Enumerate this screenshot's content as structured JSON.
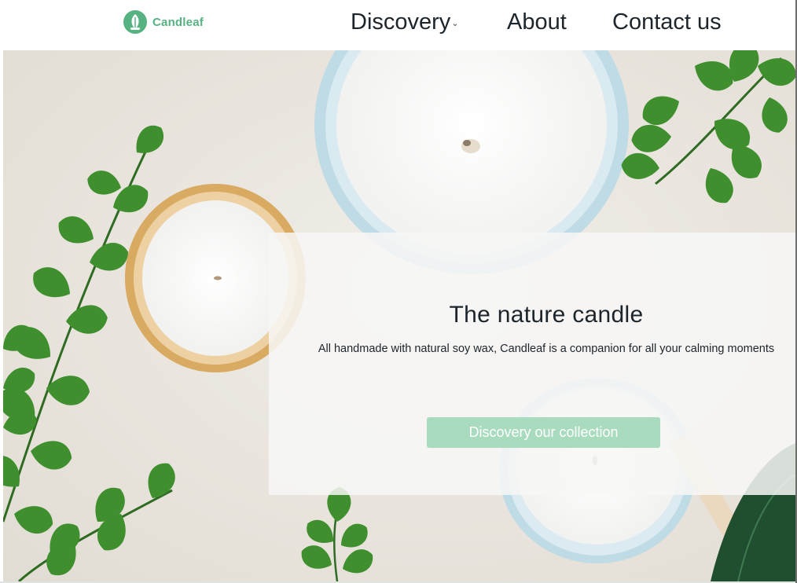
{
  "brand": {
    "name": "Candleaf",
    "color": "#56b280",
    "logo_icon": "leaf-logo-icon"
  },
  "nav": {
    "discovery": "Discovery",
    "discovery_chevron": "⌄",
    "about": "About",
    "contact": "Contact us"
  },
  "hero": {
    "title": "The nature candle",
    "subtitle": "All handmade with natural soy wax, Candleaf is a companion for all your calming moments",
    "cta_label": "Discovery our collection",
    "cta_color": "#a9dbbe"
  }
}
